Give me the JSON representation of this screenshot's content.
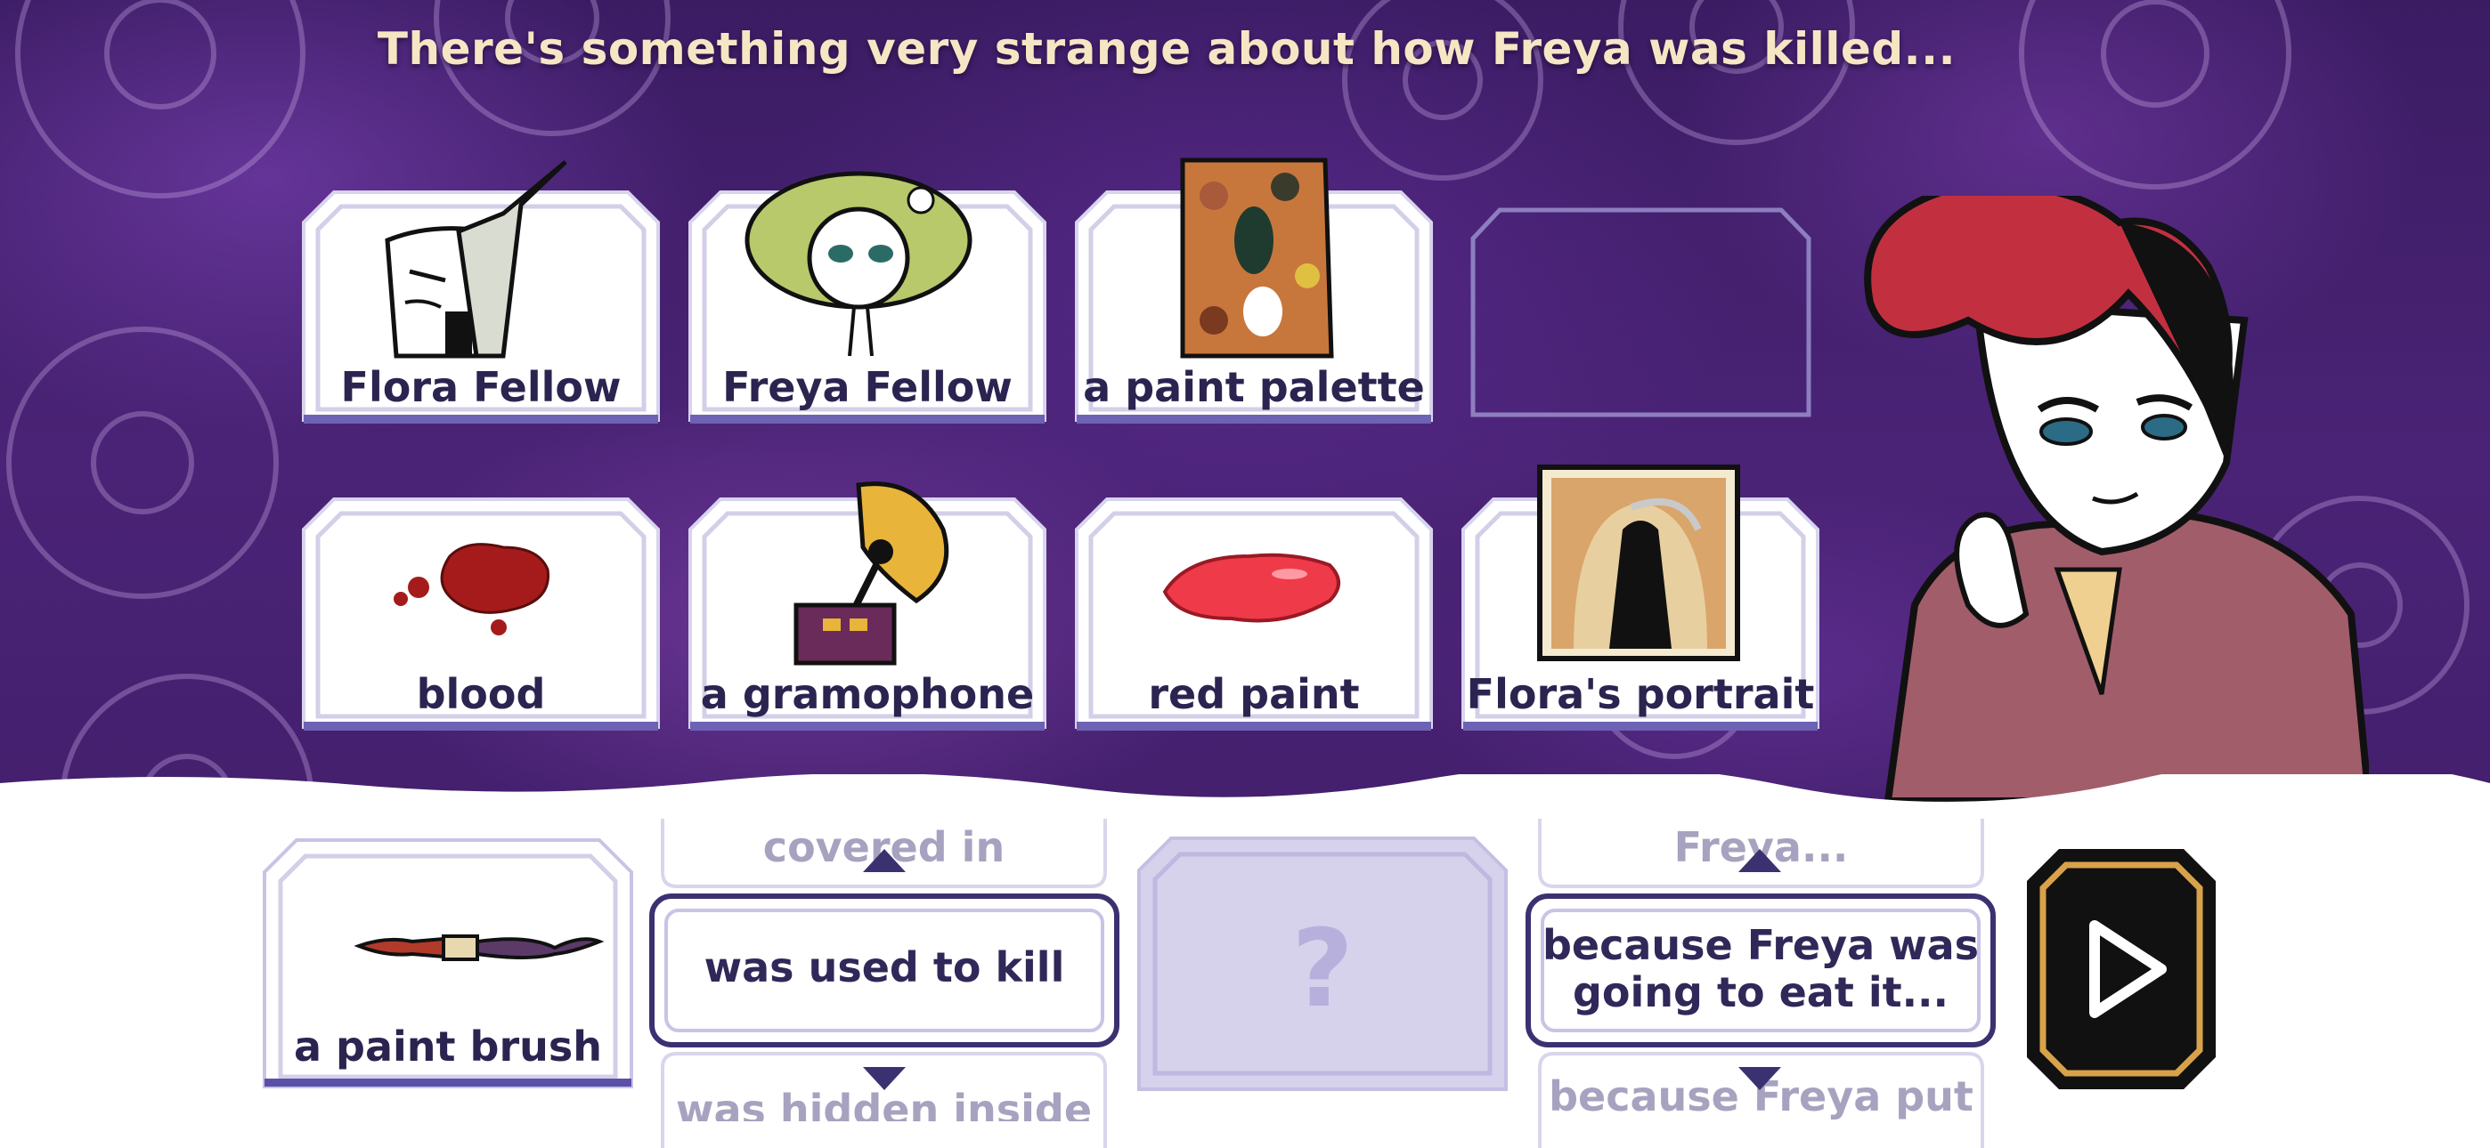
{
  "caption": "There's something very strange about how Freya was killed...",
  "clue_cards": [
    {
      "label": "Flora Fellow",
      "icon": "flora-fellow-portrait-icon"
    },
    {
      "label": "Freya Fellow",
      "icon": "freya-fellow-portrait-icon"
    },
    {
      "label": "a paint palette",
      "icon": "paint-palette-icon"
    },
    {
      "label": "blood",
      "icon": "blood-splatter-icon"
    },
    {
      "label": "a gramophone",
      "icon": "gramophone-icon"
    },
    {
      "label": "red paint",
      "icon": "red-paint-icon"
    },
    {
      "label": "Flora's portrait",
      "icon": "floras-portrait-painting-icon"
    }
  ],
  "sentence": {
    "subject_card": {
      "label": "a paint brush",
      "icon": "paint-brush-icon"
    },
    "verb_options": {
      "previous": "covered in",
      "current": "was used to kill",
      "next": "was hidden inside"
    },
    "object_placeholder": "?",
    "reason_options": {
      "previous": "Freya...",
      "current_line1": "because Freya was",
      "current_line2": "going to eat it...",
      "next": "because Freya put it"
    },
    "submit_icon": "play-icon"
  },
  "colors": {
    "caption": "#f6e6c4",
    "card_text": "#2b2450",
    "accent_gold": "#d8a24a",
    "background_purple": "#3b1c63"
  }
}
